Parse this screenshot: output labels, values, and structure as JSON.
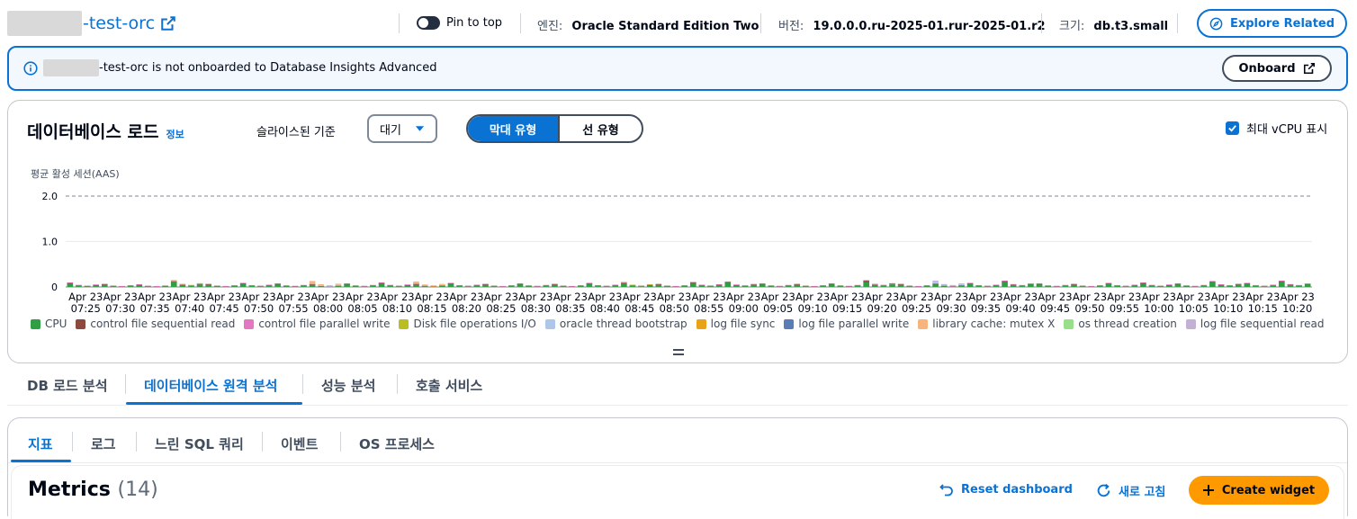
{
  "header": {
    "instance_suffix": "-test-orc",
    "pin_label": "Pin to top",
    "engine_label": "엔진:",
    "engine_value": "Oracle Standard Edition Two",
    "version_label": "버전:",
    "version_value": "19.0.0.0.ru-2025-01.rur-2025-01.r2",
    "size_label": "크기:",
    "size_value": "db.t3.small",
    "explore_label": "Explore Related"
  },
  "banner": {
    "suffix": "-test-orc",
    "message": "is not onboarded to Database Insights Advanced",
    "onboard_label": "Onboard"
  },
  "db_load": {
    "title": "데이터베이스 로드",
    "info": "정보",
    "sliced_label": "슬라이스된 기준",
    "sliced_value": "대기",
    "seg_bar": "막대 유형",
    "seg_line": "선 유형",
    "max_vcpu_label": "최대 vCPU 표시"
  },
  "chart_data": {
    "type": "bar",
    "ylabel": "평균 활성 세션(AAS)",
    "ylim": [
      0,
      2.0
    ],
    "yticks": [
      "2.0",
      "1.0",
      "0"
    ],
    "max_vcpu": 2.0,
    "x_top": [
      "Apr 23",
      "Apr 23",
      "Apr 23",
      "Apr 23",
      "Apr 23",
      "Apr 23",
      "Apr 23",
      "Apr 23",
      "Apr 23",
      "Apr 23",
      "Apr 23",
      "Apr 23",
      "Apr 23",
      "Apr 23",
      "Apr 23",
      "Apr 23",
      "Apr 23",
      "Apr 23",
      "Apr 23",
      "Apr 23",
      "Apr 23",
      "Apr 23",
      "Apr 23",
      "Apr 23",
      "Apr 23",
      "Apr 23",
      "Apr 23",
      "Apr 23",
      "Apr 23",
      "Apr 23",
      "Apr 23",
      "Apr 23",
      "Apr 23",
      "Apr 23",
      "Apr 23",
      "Apr 23"
    ],
    "x_bottom": [
      "07:25",
      "07:30",
      "07:35",
      "07:40",
      "07:45",
      "07:50",
      "07:55",
      "08:00",
      "08:05",
      "08:10",
      "08:15",
      "08:20",
      "08:25",
      "08:30",
      "08:35",
      "08:40",
      "08:45",
      "08:50",
      "08:55",
      "09:00",
      "09:05",
      "09:10",
      "09:15",
      "09:20",
      "09:25",
      "09:30",
      "09:35",
      "09:40",
      "09:45",
      "09:50",
      "09:55",
      "10:00",
      "10:05",
      "10:10",
      "10:15",
      "10:20"
    ],
    "series": [
      {
        "name": "CPU",
        "color": "#2ea043",
        "values": [
          0.08,
          0.05,
          0.04,
          0.1,
          0.05,
          0.07,
          0.06,
          0.05,
          0.06,
          0.08,
          0.05,
          0.07,
          0.05,
          0.06,
          0.05,
          0.07,
          0.08,
          0.05,
          0.09,
          0.1,
          0.06,
          0.05,
          0.06,
          0.1,
          0.05,
          0.06,
          0.07,
          0.12,
          0.06,
          0.05,
          0.07,
          0.08,
          0.06,
          0.1,
          0.07,
          0.12
        ]
      },
      {
        "name": "control file sequential read",
        "color": "#8c4a3f",
        "values": [
          0.01,
          0.01,
          0.01,
          0.02,
          0.01,
          0.01,
          0.01,
          0.01,
          0.01,
          0.01,
          0.01,
          0.01,
          0.01,
          0.01,
          0.01,
          0.01,
          0.01,
          0.01,
          0.01,
          0.01,
          0.01,
          0.01,
          0.01,
          0.04,
          0.01,
          0.01,
          0.01,
          0.01,
          0.01,
          0.01,
          0.01,
          0.01,
          0.01,
          0.02,
          0.01,
          0.01
        ]
      },
      {
        "name": "control file parallel write",
        "color": "#e377c2",
        "values": [
          0.01,
          0.01,
          0.01,
          0.01,
          0.01,
          0.01,
          0.01,
          0.01,
          0.01,
          0.01,
          0.01,
          0.01,
          0.01,
          0.01,
          0.01,
          0.01,
          0.01,
          0.01,
          0.01,
          0.01,
          0.01,
          0.01,
          0.01,
          0.01,
          0.01,
          0.01,
          0.01,
          0.01,
          0.01,
          0.01,
          0.01,
          0.01,
          0.01,
          0.01,
          0.01,
          0.01
        ]
      },
      {
        "name": "Disk file operations I/O",
        "color": "#bcbd22",
        "values": [
          0,
          0,
          0,
          0.02,
          0,
          0,
          0,
          0,
          0,
          0,
          0,
          0,
          0,
          0,
          0,
          0,
          0.01,
          0,
          0,
          0,
          0,
          0,
          0,
          0,
          0,
          0,
          0,
          0,
          0,
          0,
          0,
          0,
          0,
          0,
          0,
          0
        ]
      },
      {
        "name": "oracle thread bootstrap",
        "color": "#aec7e8",
        "values": [
          0,
          0,
          0,
          0,
          0,
          0,
          0,
          0.01,
          0,
          0,
          0,
          0,
          0,
          0,
          0,
          0,
          0,
          0,
          0,
          0,
          0,
          0,
          0,
          0,
          0,
          0.04,
          0,
          0,
          0,
          0,
          0,
          0,
          0,
          0,
          0,
          0
        ]
      },
      {
        "name": "log file sync",
        "color": "#e8a317",
        "values": [
          0,
          0,
          0,
          0,
          0,
          0,
          0,
          0,
          0,
          0,
          0.01,
          0,
          0,
          0,
          0,
          0,
          0,
          0,
          0,
          0,
          0,
          0,
          0,
          0,
          0,
          0,
          0,
          0,
          0,
          0,
          0,
          0,
          0,
          0,
          0,
          0
        ]
      },
      {
        "name": "log file parallel write",
        "color": "#5a7db8",
        "values": [
          0,
          0,
          0,
          0,
          0,
          0,
          0,
          0,
          0,
          0,
          0,
          0,
          0,
          0,
          0,
          0,
          0,
          0,
          0,
          0,
          0,
          0,
          0,
          0,
          0,
          0,
          0,
          0,
          0,
          0,
          0,
          0,
          0,
          0,
          0,
          0
        ]
      },
      {
        "name": "library cache: mutex X",
        "color": "#f7b47c",
        "values": [
          0,
          0,
          0,
          0,
          0,
          0,
          0,
          0.05,
          0,
          0,
          0.04,
          0,
          0,
          0,
          0,
          0,
          0,
          0,
          0,
          0,
          0,
          0,
          0,
          0,
          0,
          0,
          0,
          0,
          0,
          0,
          0,
          0,
          0,
          0,
          0,
          0
        ]
      },
      {
        "name": "os thread creation",
        "color": "#98df8a",
        "values": [
          0,
          0,
          0,
          0,
          0,
          0,
          0,
          0,
          0,
          0,
          0,
          0,
          0,
          0,
          0,
          0,
          0,
          0,
          0,
          0,
          0,
          0,
          0,
          0,
          0,
          0,
          0,
          0,
          0,
          0,
          0,
          0,
          0,
          0,
          0,
          0
        ]
      },
      {
        "name": "log file sequential read",
        "color": "#c5b0d5",
        "values": [
          0,
          0,
          0,
          0,
          0,
          0,
          0,
          0,
          0,
          0,
          0,
          0,
          0,
          0,
          0,
          0,
          0,
          0,
          0,
          0,
          0,
          0,
          0,
          0,
          0,
          0.02,
          0,
          0,
          0,
          0,
          0,
          0,
          0,
          0,
          0,
          0
        ]
      }
    ],
    "legend_placement": "bottom",
    "grid": true
  },
  "tabs1": [
    "DB 로드 분석",
    "데이터베이스 원격 분석",
    "성능 분석",
    "호출 서비스"
  ],
  "tabs2": [
    "지표",
    "로그",
    "느린 SQL 쿼리",
    "이벤트",
    "OS 프로세스"
  ],
  "metrics": {
    "title": "Metrics",
    "count": "(14)",
    "reset_label": "Reset dashboard",
    "refresh_label": "새로 고침",
    "create_label": "Create widget"
  },
  "colors": {
    "accent": "#0972d3",
    "primary_button": "#ff9900"
  }
}
